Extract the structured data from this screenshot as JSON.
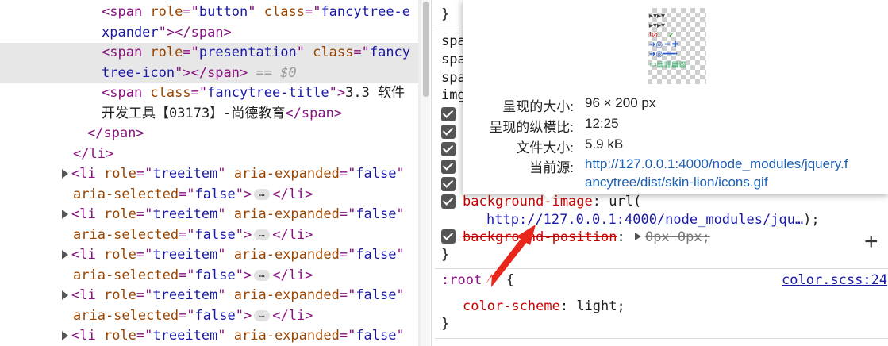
{
  "elements": {
    "lines": [
      {
        "indent": 128,
        "parts": [
          {
            "c": "tag",
            "t": "<span "
          },
          {
            "c": "attr",
            "t": "role"
          },
          {
            "c": "tag",
            "t": "=\""
          },
          {
            "c": "val",
            "t": "button"
          },
          {
            "c": "tag",
            "t": "\" "
          },
          {
            "c": "attr",
            "t": "class"
          },
          {
            "c": "tag",
            "t": "=\""
          },
          {
            "c": "val",
            "t": "fancytree-e"
          }
        ]
      },
      {
        "indent": 128,
        "parts": [
          {
            "c": "val",
            "t": "xpander"
          },
          {
            "c": "tag",
            "t": "\"></span>"
          }
        ]
      },
      {
        "indent": 128,
        "hl": true,
        "parts": [
          {
            "c": "tag",
            "t": "<span "
          },
          {
            "c": "attr",
            "t": "role"
          },
          {
            "c": "tag",
            "t": "=\""
          },
          {
            "c": "val",
            "t": "presentation"
          },
          {
            "c": "tag",
            "t": "\" "
          },
          {
            "c": "attr",
            "t": "class"
          },
          {
            "c": "tag",
            "t": "=\""
          },
          {
            "c": "val",
            "t": "fancy"
          }
        ]
      },
      {
        "indent": 128,
        "hl": true,
        "parts": [
          {
            "c": "val",
            "t": "tree-icon"
          },
          {
            "c": "tag",
            "t": "\"></span>"
          },
          {
            "c": "dim",
            "t": " == $0"
          }
        ]
      },
      {
        "indent": 128,
        "parts": [
          {
            "c": "tag",
            "t": "<span "
          },
          {
            "c": "attr",
            "t": "class"
          },
          {
            "c": "tag",
            "t": "=\""
          },
          {
            "c": "val",
            "t": "fancytree-title"
          },
          {
            "c": "tag",
            "t": "\">"
          },
          {
            "c": "txt",
            "t": "3.3 软件"
          }
        ]
      },
      {
        "indent": 128,
        "parts": [
          {
            "c": "txt",
            "t": "开发工具【03173】-尚德教育"
          },
          {
            "c": "tag",
            "t": "</span>"
          }
        ]
      },
      {
        "indent": 110,
        "parts": [
          {
            "c": "tag",
            "t": "</span>"
          }
        ]
      },
      {
        "indent": 92,
        "parts": [
          {
            "c": "tag",
            "t": "</li>"
          }
        ]
      },
      {
        "indent": 78,
        "tri": true,
        "parts": [
          {
            "c": "tag",
            "t": "<li "
          },
          {
            "c": "attr",
            "t": "role"
          },
          {
            "c": "tag",
            "t": "=\""
          },
          {
            "c": "val",
            "t": "treeitem"
          },
          {
            "c": "tag",
            "t": "\" "
          },
          {
            "c": "attr",
            "t": "aria-expanded"
          },
          {
            "c": "tag",
            "t": "=\""
          },
          {
            "c": "val",
            "t": "false"
          },
          {
            "c": "tag",
            "t": "\""
          }
        ]
      },
      {
        "indent": 92,
        "pill": true,
        "parts": [
          {
            "c": "attr",
            "t": "aria-selected"
          },
          {
            "c": "tag",
            "t": "=\""
          },
          {
            "c": "val",
            "t": "false"
          },
          {
            "c": "tag",
            "t": "\">"
          }
        ],
        "after": "</li>"
      },
      {
        "indent": 78,
        "tri": true,
        "parts": [
          {
            "c": "tag",
            "t": "<li "
          },
          {
            "c": "attr",
            "t": "role"
          },
          {
            "c": "tag",
            "t": "=\""
          },
          {
            "c": "val",
            "t": "treeitem"
          },
          {
            "c": "tag",
            "t": "\" "
          },
          {
            "c": "attr",
            "t": "aria-expanded"
          },
          {
            "c": "tag",
            "t": "=\""
          },
          {
            "c": "val",
            "t": "false"
          },
          {
            "c": "tag",
            "t": "\""
          }
        ]
      },
      {
        "indent": 92,
        "pill": true,
        "parts": [
          {
            "c": "attr",
            "t": "aria-selected"
          },
          {
            "c": "tag",
            "t": "=\""
          },
          {
            "c": "val",
            "t": "false"
          },
          {
            "c": "tag",
            "t": "\">"
          }
        ],
        "after": "</li>"
      },
      {
        "indent": 78,
        "tri": true,
        "parts": [
          {
            "c": "tag",
            "t": "<li "
          },
          {
            "c": "attr",
            "t": "role"
          },
          {
            "c": "tag",
            "t": "=\""
          },
          {
            "c": "val",
            "t": "treeitem"
          },
          {
            "c": "tag",
            "t": "\" "
          },
          {
            "c": "attr",
            "t": "aria-expanded"
          },
          {
            "c": "tag",
            "t": "=\""
          },
          {
            "c": "val",
            "t": "false"
          },
          {
            "c": "tag",
            "t": "\""
          }
        ]
      },
      {
        "indent": 92,
        "pill": true,
        "parts": [
          {
            "c": "attr",
            "t": "aria-selected"
          },
          {
            "c": "tag",
            "t": "=\""
          },
          {
            "c": "val",
            "t": "false"
          },
          {
            "c": "tag",
            "t": "\">"
          }
        ],
        "after": "</li>"
      },
      {
        "indent": 78,
        "tri": true,
        "parts": [
          {
            "c": "tag",
            "t": "<li "
          },
          {
            "c": "attr",
            "t": "role"
          },
          {
            "c": "tag",
            "t": "=\""
          },
          {
            "c": "val",
            "t": "treeitem"
          },
          {
            "c": "tag",
            "t": "\" "
          },
          {
            "c": "attr",
            "t": "aria-expanded"
          },
          {
            "c": "tag",
            "t": "=\""
          },
          {
            "c": "val",
            "t": "false"
          },
          {
            "c": "tag",
            "t": "\""
          }
        ]
      },
      {
        "indent": 92,
        "pill": true,
        "parts": [
          {
            "c": "attr",
            "t": "aria-selected"
          },
          {
            "c": "tag",
            "t": "=\""
          },
          {
            "c": "val",
            "t": "false"
          },
          {
            "c": "tag",
            "t": "\">"
          }
        ],
        "after": "</li>"
      },
      {
        "indent": 78,
        "tri": true,
        "parts": [
          {
            "c": "tag",
            "t": "<li "
          },
          {
            "c": "attr",
            "t": "role"
          },
          {
            "c": "tag",
            "t": "=\""
          },
          {
            "c": "val",
            "t": "treeitem"
          },
          {
            "c": "tag",
            "t": "\" "
          },
          {
            "c": "attr",
            "t": "aria-expanded"
          },
          {
            "c": "tag",
            "t": "=\""
          },
          {
            "c": "val",
            "t": "false"
          },
          {
            "c": "tag",
            "t": "\""
          }
        ]
      }
    ],
    "ellipsis": "…"
  },
  "styles": {
    "rule_close_top": "}",
    "partial_props": [
      "spa",
      "spa",
      "spa",
      "img"
    ],
    "background_image_prop": "background-image",
    "background_image_value_prefix": ": url(",
    "background_image_url": "http://127.0.0.1:4000/node_modules/jqu…",
    "background_image_value_suffix": ");",
    "background_position_prop": "background-position",
    "background_position_value": "0px 0px",
    "rule_close": "}",
    "root_selector": ":root",
    "root_brace": "{",
    "root_source": "color.scss:24",
    "color_scheme_prop": "color-scheme",
    "color_scheme_value": "light",
    "root_close": "}",
    "add_property_label": "+"
  },
  "tooltip": {
    "rendered_size_label": "呈现的大小:",
    "rendered_size_value": "96 × 200 px",
    "aspect_label": "呈现的纵横比:",
    "aspect_value": "12:25",
    "file_size_label": "文件大小:",
    "file_size_value": "5.9 kB",
    "source_label": "当前源:",
    "source_value_line1": "http://127.0.0.1:4000/node_modules/jquery.f",
    "source_value_line2": "ancytree/dist/skin-lion/icons.gif",
    "image_name": "icons.gif"
  },
  "colors": {
    "tag": "#881280",
    "attr": "#994500",
    "value": "#1a1aa6",
    "property": "#c80000",
    "arrow": "#e8261c",
    "highlight": "#e7e7e7"
  }
}
